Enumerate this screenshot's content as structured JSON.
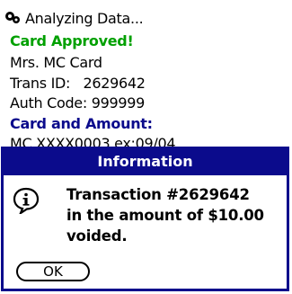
{
  "app": {
    "title": "Analyzing Data..."
  },
  "status": {
    "approved": "Card Approved!",
    "name": "Mrs. MC Card",
    "trans_id_line": "Trans ID:   2629642",
    "auth_code_line": "Auth Code: 999999",
    "card_amount_heading": "Card and Amount:",
    "card_line": "MC XXXX0003 ex:09/04"
  },
  "dialog": {
    "title": "Information",
    "message_line1": "Transaction #2629642",
    "message_line2": "in the amount of $10.00",
    "message_line3": "voided.",
    "ok_label": "OK"
  },
  "colors": {
    "approved": "#00a000",
    "heading": "#0b0b8c",
    "dialog_frame": "#0b0b8c"
  }
}
